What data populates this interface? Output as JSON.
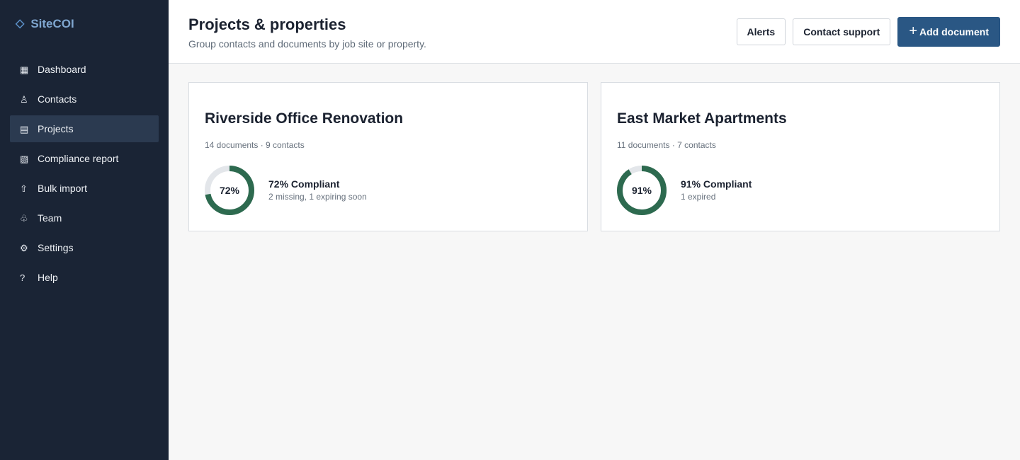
{
  "app": {
    "name": "SiteCOI",
    "logo_icon": "diamond-icon"
  },
  "sidebar": {
    "items": [
      {
        "label": "Dashboard",
        "icon": "dashboard-icon",
        "glyph": "▦",
        "active": false
      },
      {
        "label": "Contacts",
        "icon": "person-icon",
        "glyph": "♙",
        "active": false
      },
      {
        "label": "Projects",
        "icon": "projects-icon",
        "glyph": "▤",
        "active": true
      },
      {
        "label": "Compliance report",
        "icon": "report-icon",
        "glyph": "▧",
        "active": false
      },
      {
        "label": "Bulk import",
        "icon": "upload-icon",
        "glyph": "⇧",
        "active": false
      },
      {
        "label": "Team",
        "icon": "team-icon",
        "glyph": "♧",
        "active": false
      },
      {
        "label": "Settings",
        "icon": "gear-icon",
        "glyph": "⚙",
        "active": false
      },
      {
        "label": "Help",
        "icon": "help-icon",
        "glyph": "?",
        "active": false
      }
    ]
  },
  "header": {
    "title": "Projects & properties",
    "subtitle": "Group contacts and documents by job site or property.",
    "alerts_label": "Alerts",
    "contact_support_label": "Contact support",
    "add_document_label": "Add document"
  },
  "projects": [
    {
      "name": "Riverside Office Renovation",
      "meta": "14 documents · 9 contacts",
      "compliance_percent": 72,
      "percent_label": "72%",
      "status_title": "72% Compliant",
      "status_detail": "2 missing, 1 expiring soon"
    },
    {
      "name": "East Market Apartments",
      "meta": "11 documents · 7 contacts",
      "compliance_percent": 91,
      "percent_label": "91%",
      "status_title": "91% Compliant",
      "status_detail": "1 expired"
    }
  ],
  "colors": {
    "sidebar_bg": "#1a2435",
    "active_nav_bg": "#2b3a50",
    "brand": "#7fa6cf",
    "primary_button": "#2a5784",
    "donut_fill": "#2d6a4f",
    "donut_track": "#e3e6ea"
  }
}
